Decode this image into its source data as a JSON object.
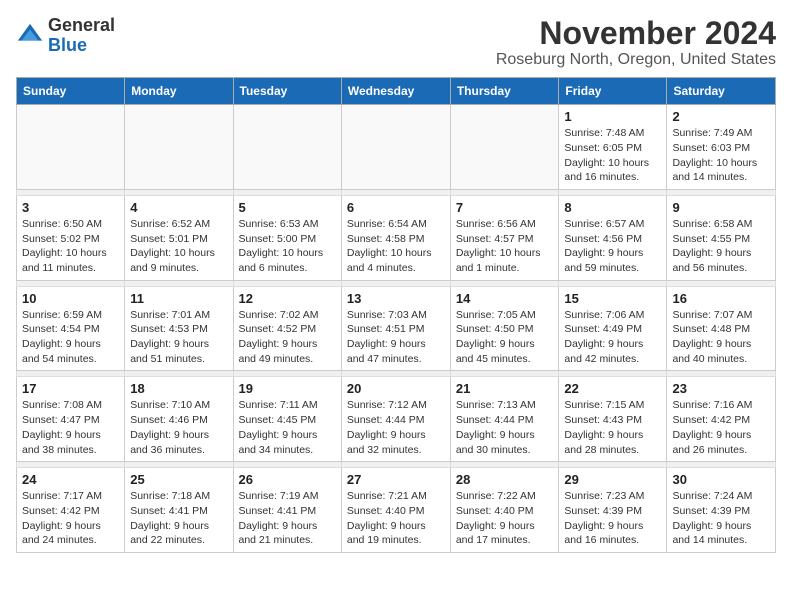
{
  "header": {
    "logo": {
      "general": "General",
      "blue": "Blue"
    },
    "title": "November 2024",
    "location": "Roseburg North, Oregon, United States"
  },
  "columns": [
    "Sunday",
    "Monday",
    "Tuesday",
    "Wednesday",
    "Thursday",
    "Friday",
    "Saturday"
  ],
  "weeks": [
    {
      "days": [
        {
          "num": "",
          "info": ""
        },
        {
          "num": "",
          "info": ""
        },
        {
          "num": "",
          "info": ""
        },
        {
          "num": "",
          "info": ""
        },
        {
          "num": "",
          "info": ""
        },
        {
          "num": "1",
          "info": "Sunrise: 7:48 AM\nSunset: 6:05 PM\nDaylight: 10 hours and 16 minutes."
        },
        {
          "num": "2",
          "info": "Sunrise: 7:49 AM\nSunset: 6:03 PM\nDaylight: 10 hours and 14 minutes."
        }
      ]
    },
    {
      "days": [
        {
          "num": "3",
          "info": "Sunrise: 6:50 AM\nSunset: 5:02 PM\nDaylight: 10 hours and 11 minutes."
        },
        {
          "num": "4",
          "info": "Sunrise: 6:52 AM\nSunset: 5:01 PM\nDaylight: 10 hours and 9 minutes."
        },
        {
          "num": "5",
          "info": "Sunrise: 6:53 AM\nSunset: 5:00 PM\nDaylight: 10 hours and 6 minutes."
        },
        {
          "num": "6",
          "info": "Sunrise: 6:54 AM\nSunset: 4:58 PM\nDaylight: 10 hours and 4 minutes."
        },
        {
          "num": "7",
          "info": "Sunrise: 6:56 AM\nSunset: 4:57 PM\nDaylight: 10 hours and 1 minute."
        },
        {
          "num": "8",
          "info": "Sunrise: 6:57 AM\nSunset: 4:56 PM\nDaylight: 9 hours and 59 minutes."
        },
        {
          "num": "9",
          "info": "Sunrise: 6:58 AM\nSunset: 4:55 PM\nDaylight: 9 hours and 56 minutes."
        }
      ]
    },
    {
      "days": [
        {
          "num": "10",
          "info": "Sunrise: 6:59 AM\nSunset: 4:54 PM\nDaylight: 9 hours and 54 minutes."
        },
        {
          "num": "11",
          "info": "Sunrise: 7:01 AM\nSunset: 4:53 PM\nDaylight: 9 hours and 51 minutes."
        },
        {
          "num": "12",
          "info": "Sunrise: 7:02 AM\nSunset: 4:52 PM\nDaylight: 9 hours and 49 minutes."
        },
        {
          "num": "13",
          "info": "Sunrise: 7:03 AM\nSunset: 4:51 PM\nDaylight: 9 hours and 47 minutes."
        },
        {
          "num": "14",
          "info": "Sunrise: 7:05 AM\nSunset: 4:50 PM\nDaylight: 9 hours and 45 minutes."
        },
        {
          "num": "15",
          "info": "Sunrise: 7:06 AM\nSunset: 4:49 PM\nDaylight: 9 hours and 42 minutes."
        },
        {
          "num": "16",
          "info": "Sunrise: 7:07 AM\nSunset: 4:48 PM\nDaylight: 9 hours and 40 minutes."
        }
      ]
    },
    {
      "days": [
        {
          "num": "17",
          "info": "Sunrise: 7:08 AM\nSunset: 4:47 PM\nDaylight: 9 hours and 38 minutes."
        },
        {
          "num": "18",
          "info": "Sunrise: 7:10 AM\nSunset: 4:46 PM\nDaylight: 9 hours and 36 minutes."
        },
        {
          "num": "19",
          "info": "Sunrise: 7:11 AM\nSunset: 4:45 PM\nDaylight: 9 hours and 34 minutes."
        },
        {
          "num": "20",
          "info": "Sunrise: 7:12 AM\nSunset: 4:44 PM\nDaylight: 9 hours and 32 minutes."
        },
        {
          "num": "21",
          "info": "Sunrise: 7:13 AM\nSunset: 4:44 PM\nDaylight: 9 hours and 30 minutes."
        },
        {
          "num": "22",
          "info": "Sunrise: 7:15 AM\nSunset: 4:43 PM\nDaylight: 9 hours and 28 minutes."
        },
        {
          "num": "23",
          "info": "Sunrise: 7:16 AM\nSunset: 4:42 PM\nDaylight: 9 hours and 26 minutes."
        }
      ]
    },
    {
      "days": [
        {
          "num": "24",
          "info": "Sunrise: 7:17 AM\nSunset: 4:42 PM\nDaylight: 9 hours and 24 minutes."
        },
        {
          "num": "25",
          "info": "Sunrise: 7:18 AM\nSunset: 4:41 PM\nDaylight: 9 hours and 22 minutes."
        },
        {
          "num": "26",
          "info": "Sunrise: 7:19 AM\nSunset: 4:41 PM\nDaylight: 9 hours and 21 minutes."
        },
        {
          "num": "27",
          "info": "Sunrise: 7:21 AM\nSunset: 4:40 PM\nDaylight: 9 hours and 19 minutes."
        },
        {
          "num": "28",
          "info": "Sunrise: 7:22 AM\nSunset: 4:40 PM\nDaylight: 9 hours and 17 minutes."
        },
        {
          "num": "29",
          "info": "Sunrise: 7:23 AM\nSunset: 4:39 PM\nDaylight: 9 hours and 16 minutes."
        },
        {
          "num": "30",
          "info": "Sunrise: 7:24 AM\nSunset: 4:39 PM\nDaylight: 9 hours and 14 minutes."
        }
      ]
    }
  ]
}
